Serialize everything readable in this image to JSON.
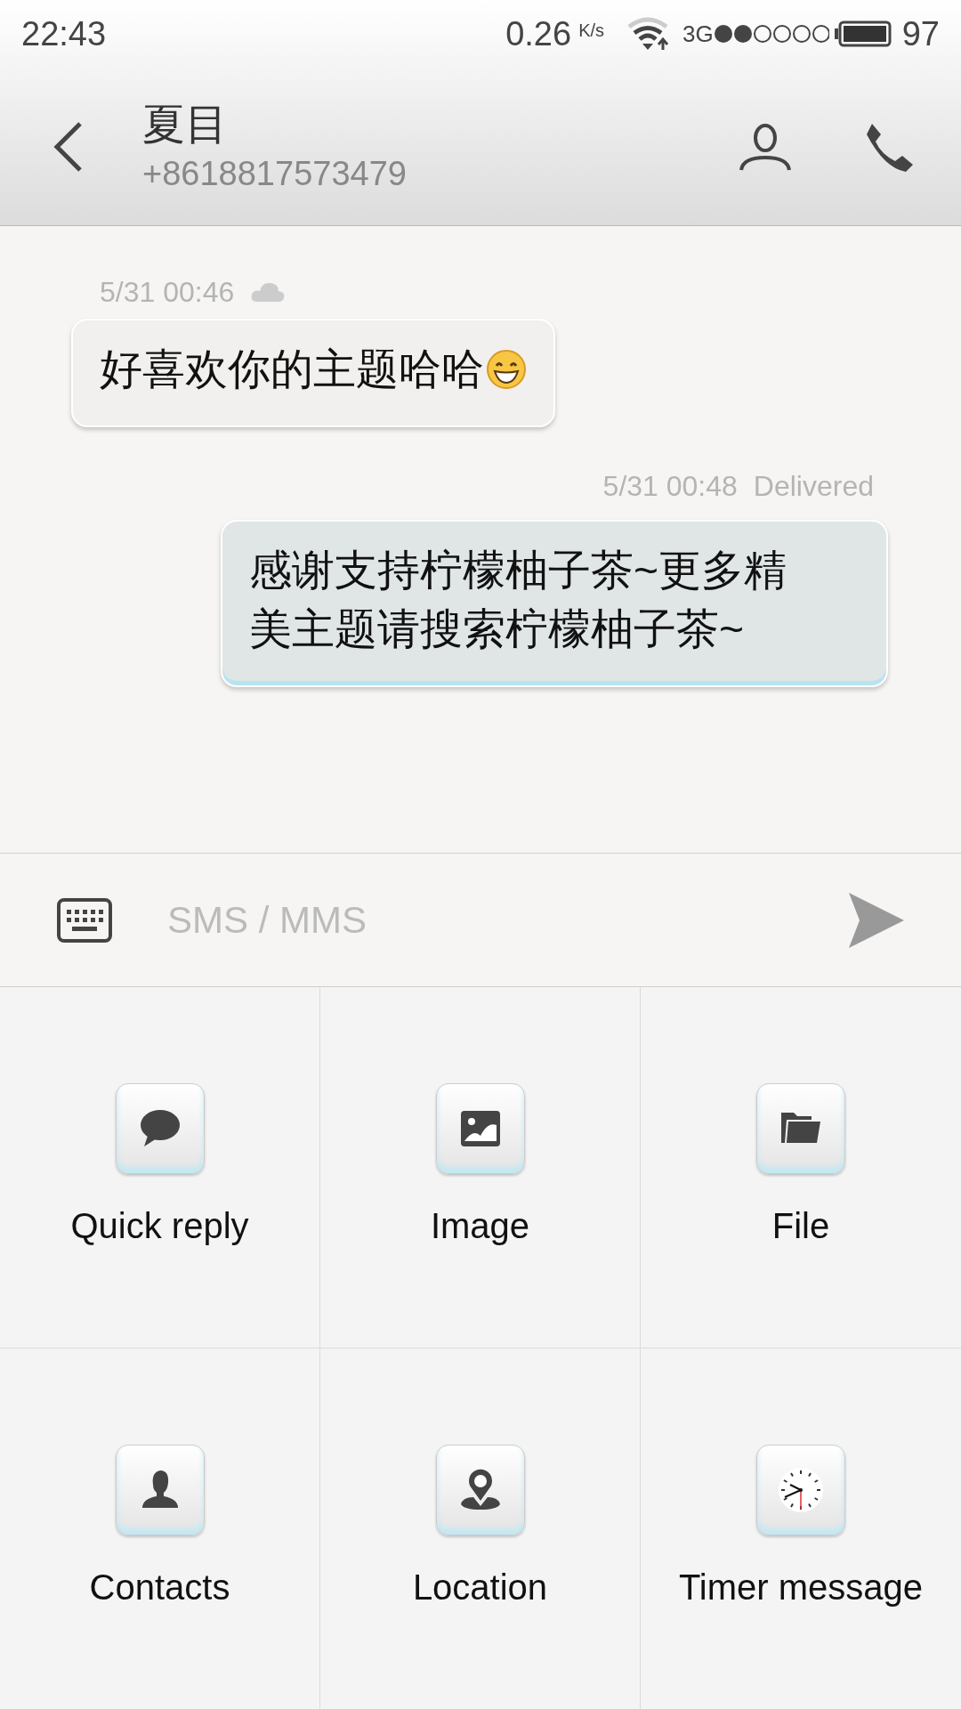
{
  "status_bar": {
    "time": "22:43",
    "speed": "0.26",
    "speed_unit": "K/s",
    "network": "3G",
    "battery": "97"
  },
  "header": {
    "title": "夏目",
    "subtitle": "+8618817573479"
  },
  "messages": [
    {
      "kind": "received",
      "meta": [
        "5/31 00:46"
      ],
      "cloud": true,
      "text": "好喜欢你的主题哈哈",
      "has_emoji": true
    },
    {
      "kind": "sent",
      "meta": [
        "5/31 00:48",
        "Delivered"
      ],
      "cloud": false,
      "text": "感谢支持柠檬柚子茶~更多精美主题请搜索柠檬柚子茶~",
      "has_emoji": false
    }
  ],
  "composer": {
    "placeholder": "SMS / MMS"
  },
  "attachments": [
    {
      "kind": "chat",
      "label": "Quick reply"
    },
    {
      "kind": "image",
      "label": "Image"
    },
    {
      "kind": "folder",
      "label": "File"
    },
    {
      "kind": "person",
      "label": "Contacts"
    },
    {
      "kind": "pin",
      "label": "Location"
    },
    {
      "kind": "clock",
      "label": "Timer message"
    }
  ]
}
